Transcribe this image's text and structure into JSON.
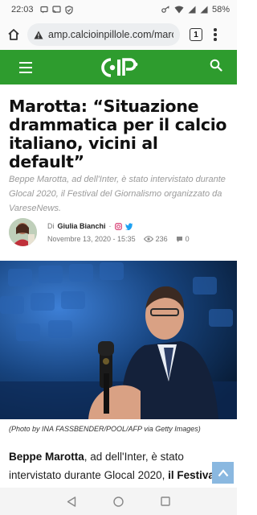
{
  "status_bar": {
    "time": "22:03",
    "battery": "58%"
  },
  "browser": {
    "url": "amp.calcioinpillole.com/marot",
    "tab_count": "1"
  },
  "site": {
    "logo_text": "CIP"
  },
  "article": {
    "title": "Marotta: “Situazione drammatica per il calcio italiano, vicini al default”",
    "excerpt": "Beppe Marotta, ad dell'Inter, è stato intervistato durante Glocal 2020, il Festival del Giornalismo organizzato da VareseNews.",
    "byline_prefix": "Di",
    "author": "Giulia Bianchi",
    "date": "Novembre 13, 2020 - 15:35",
    "views": "236",
    "comments": "0",
    "caption": "(Photo by INA FASSBENDER/POOL/AFP via Getty Images)",
    "body_lead_bold": "Beppe Marotta",
    "body_lead_rest": ", ad dell'Inter, è stato intervistato durante Glocal 2020, ",
    "body_bold_2": "il Festival del Giornalismo organizzato"
  },
  "colors": {
    "brand_green": "#2e9c2e",
    "excerpt_gray": "#9a9a9a",
    "scroll_button": "#8ab8e0"
  },
  "icons": {
    "home": "home-icon",
    "warning": "warning-icon",
    "menu": "hamburger-icon",
    "search": "search-icon",
    "instagram": "instagram-icon",
    "twitter": "twitter-icon",
    "views": "eye-icon",
    "comments": "comment-icon",
    "scroll_top": "arrow-up-icon",
    "back": "back-triangle-icon",
    "home_nav": "home-circle-icon",
    "recents": "recents-square-icon"
  }
}
